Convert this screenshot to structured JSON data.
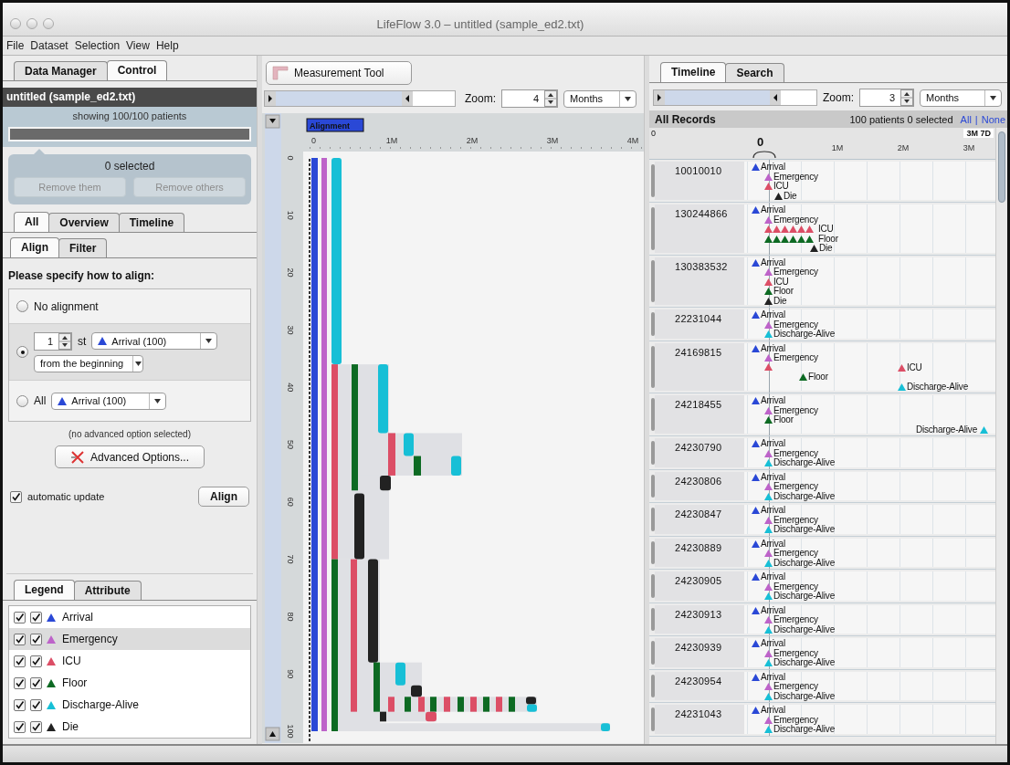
{
  "window": {
    "title": "LifeFlow 3.0 – untitled (sample_ed2.txt)"
  },
  "menu": [
    "File",
    "Dataset",
    "Selection",
    "View",
    "Help"
  ],
  "left": {
    "tabs": [
      {
        "label": "Data Manager",
        "selected": false
      },
      {
        "label": "Control",
        "selected": true
      }
    ],
    "dataset": {
      "title": "untitled (sample_ed2.txt)",
      "showing": "showing 100/100 patients",
      "level": 1
    },
    "selection": {
      "count": "0 selected",
      "buttons": [
        {
          "label": "Remove them",
          "disabled": true
        },
        {
          "label": "Remove others",
          "disabled": true
        }
      ]
    },
    "view_tabs": [
      {
        "label": "All",
        "selected": true
      },
      {
        "label": "Overview",
        "selected": false
      },
      {
        "label": "Timeline",
        "selected": false
      }
    ],
    "sub_tabs": [
      {
        "label": "Align",
        "selected": true
      },
      {
        "label": "Filter",
        "selected": false
      }
    ],
    "prompt": "Please specify how to align:",
    "align_options": [
      {
        "kind": "plain",
        "label": "No alignment",
        "selected": false
      },
      {
        "kind": "nth",
        "selected": true,
        "spinner": "1",
        "suffix": "st",
        "event": {
          "label": "Arrival (100)",
          "color": "#2a48d6"
        },
        "from": "from the beginning"
      },
      {
        "kind": "all",
        "label": "All",
        "selected": false,
        "event": {
          "label": "Arrival (100)",
          "color": "#2a48d6"
        }
      }
    ],
    "advanced_note": "(no advanced option selected)",
    "advanced_button": "Advanced Options...",
    "auto_update": {
      "label": "automatic update",
      "checked": true
    },
    "align_button": "Align",
    "legend_tabs": [
      {
        "label": "Legend",
        "selected": true
      },
      {
        "label": "Attribute",
        "selected": false
      }
    ],
    "legend": [
      {
        "label": "Arrival",
        "color": "#2a48d6",
        "checked": true,
        "included": true,
        "selected": false
      },
      {
        "label": "Emergency",
        "color": "#bd63c9",
        "checked": true,
        "included": true,
        "selected": true
      },
      {
        "label": "ICU",
        "color": "#dc4e66",
        "checked": true,
        "included": true,
        "selected": false
      },
      {
        "label": "Floor",
        "color": "#0d6a23",
        "checked": true,
        "included": true,
        "selected": false
      },
      {
        "label": "Discharge-Alive",
        "color": "#17bfd6",
        "checked": true,
        "included": true,
        "selected": false
      },
      {
        "label": "Die",
        "color": "#222222",
        "checked": true,
        "included": true,
        "selected": false
      }
    ]
  },
  "middle": {
    "measure_button": "Measurement Tool",
    "zoom": {
      "label": "Zoom:",
      "value": "4",
      "unit": "Months"
    },
    "alignment_tag": "Alignment",
    "x_ticks": [
      "0",
      "1M",
      "2M",
      "3M",
      "4M"
    ],
    "y_ticks": [
      "0",
      "10",
      "20",
      "30",
      "40",
      "50",
      "60",
      "70",
      "80",
      "90",
      "100"
    ]
  },
  "right": {
    "tabs": [
      {
        "label": "Timeline",
        "selected": true
      },
      {
        "label": "Search",
        "selected": false
      }
    ],
    "zoom": {
      "label": "Zoom:",
      "value": "3",
      "unit": "Months"
    },
    "header": {
      "title": "All Records",
      "summary": "100 patients 0 selected",
      "links": [
        "All",
        "None"
      ],
      "separator": "|"
    },
    "axis": {
      "start": "0",
      "end": "3M 7D",
      "zero": "0",
      "ticks": [
        "1M",
        "2M",
        "3M"
      ]
    },
    "records": [
      {
        "id": "10010010",
        "lines": [
          [
            {
              "kind": "first",
              "color": "#2a48d6",
              "label": "Arrival"
            }
          ],
          [
            {
              "kind": "zero",
              "color": "#bd63c9",
              "label": "Emergency"
            }
          ],
          [
            {
              "kind": "zero",
              "color": "#dc4e66",
              "label": "ICU"
            }
          ],
          [
            {
              "kind": "near",
              "color": "#222222",
              "label": "Die"
            }
          ]
        ]
      },
      {
        "id": "130244866",
        "lines": [
          [
            {
              "kind": "first",
              "color": "#2a48d6",
              "label": "Arrival"
            }
          ],
          [
            {
              "kind": "zero",
              "color": "#bd63c9",
              "label": "Emergency"
            }
          ],
          [
            {
              "kind": "cluster",
              "color": "#dc4e66",
              "label": "ICU"
            }
          ],
          [
            {
              "kind": "cluster",
              "color": "#0d6a23",
              "label": "Floor"
            }
          ],
          [
            {
              "kind": "after",
              "color": "#222222",
              "label": "Die"
            }
          ]
        ]
      },
      {
        "id": "130383532",
        "lines": [
          [
            {
              "kind": "first",
              "color": "#2a48d6",
              "label": "Arrival"
            }
          ],
          [
            {
              "kind": "zero",
              "color": "#bd63c9",
              "label": "Emergency"
            }
          ],
          [
            {
              "kind": "zero",
              "color": "#dc4e66",
              "label": "ICU"
            }
          ],
          [
            {
              "kind": "zero",
              "color": "#0d6a23",
              "label": "Floor"
            }
          ],
          [
            {
              "kind": "zero",
              "color": "#222222",
              "label": "Die"
            }
          ]
        ]
      },
      {
        "id": "22231044",
        "lines": [
          [
            {
              "kind": "first",
              "color": "#2a48d6",
              "label": "Arrival"
            }
          ],
          [
            {
              "kind": "zero",
              "color": "#bd63c9",
              "label": "Emergency"
            }
          ],
          [
            {
              "kind": "zero",
              "color": "#17bfd6",
              "label": "Discharge-Alive"
            }
          ]
        ]
      },
      {
        "id": "24169815",
        "lines": [
          [
            {
              "kind": "first",
              "color": "#2a48d6",
              "label": "Arrival"
            }
          ],
          [
            {
              "kind": "zero",
              "color": "#bd63c9",
              "label": "Emergency"
            }
          ],
          [
            {
              "kind": "zero",
              "color": "#dc4e66"
            },
            {
              "kind": "far",
              "color": "#dc4e66",
              "label": "ICU"
            }
          ],
          [
            {
              "kind": "half",
              "color": "#0d6a23",
              "label": "Floor"
            }
          ],
          [
            {
              "kind": "far",
              "color": "#17bfd6",
              "label": "Discharge-Alive"
            }
          ]
        ]
      },
      {
        "id": "24218455",
        "lines": [
          [
            {
              "kind": "first",
              "color": "#2a48d6",
              "label": "Arrival"
            }
          ],
          [
            {
              "kind": "zero",
              "color": "#bd63c9",
              "label": "Emergency"
            }
          ],
          [
            {
              "kind": "zero",
              "color": "#0d6a23",
              "label": "Floor"
            }
          ],
          [
            {
              "kind": "far-left",
              "color": "#17bfd6",
              "label": "Discharge-Alive"
            }
          ]
        ]
      },
      {
        "id": "24230790",
        "lines": [
          [
            {
              "kind": "first",
              "color": "#2a48d6",
              "label": "Arrival"
            }
          ],
          [
            {
              "kind": "zero",
              "color": "#bd63c9",
              "label": "Emergency"
            }
          ],
          [
            {
              "kind": "zero",
              "color": "#17bfd6",
              "label": "Discharge-Alive"
            }
          ]
        ]
      },
      {
        "id": "24230806",
        "lines": [
          [
            {
              "kind": "first",
              "color": "#2a48d6",
              "label": "Arrival"
            }
          ],
          [
            {
              "kind": "zero",
              "color": "#bd63c9",
              "label": "Emergency"
            }
          ],
          [
            {
              "kind": "zero",
              "color": "#17bfd6",
              "label": "Discharge-Alive"
            }
          ]
        ]
      },
      {
        "id": "24230847",
        "lines": [
          [
            {
              "kind": "first",
              "color": "#2a48d6",
              "label": "Arrival"
            }
          ],
          [
            {
              "kind": "zero",
              "color": "#bd63c9",
              "label": "Emergency"
            }
          ],
          [
            {
              "kind": "zero",
              "color": "#17bfd6",
              "label": "Discharge-Alive"
            }
          ]
        ]
      },
      {
        "id": "24230889",
        "lines": [
          [
            {
              "kind": "first",
              "color": "#2a48d6",
              "label": "Arrival"
            }
          ],
          [
            {
              "kind": "zero",
              "color": "#bd63c9",
              "label": "Emergency"
            }
          ],
          [
            {
              "kind": "zero",
              "color": "#17bfd6",
              "label": "Discharge-Alive"
            }
          ]
        ]
      },
      {
        "id": "24230905",
        "lines": [
          [
            {
              "kind": "first",
              "color": "#2a48d6",
              "label": "Arrival"
            }
          ],
          [
            {
              "kind": "zero",
              "color": "#bd63c9",
              "label": "Emergency"
            }
          ],
          [
            {
              "kind": "zero",
              "color": "#17bfd6",
              "label": "Discharge-Alive"
            }
          ]
        ]
      },
      {
        "id": "24230913",
        "lines": [
          [
            {
              "kind": "first",
              "color": "#2a48d6",
              "label": "Arrival"
            }
          ],
          [
            {
              "kind": "zero",
              "color": "#bd63c9",
              "label": "Emergency"
            }
          ],
          [
            {
              "kind": "zero",
              "color": "#17bfd6",
              "label": "Discharge-Alive"
            }
          ]
        ]
      },
      {
        "id": "24230939",
        "lines": [
          [
            {
              "kind": "first",
              "color": "#2a48d6",
              "label": "Arrival"
            }
          ],
          [
            {
              "kind": "zero",
              "color": "#bd63c9",
              "label": "Emergency"
            }
          ],
          [
            {
              "kind": "zero",
              "color": "#17bfd6",
              "label": "Discharge-Alive"
            }
          ]
        ]
      },
      {
        "id": "24230954",
        "lines": [
          [
            {
              "kind": "first",
              "color": "#2a48d6",
              "label": "Arrival"
            }
          ],
          [
            {
              "kind": "zero",
              "color": "#bd63c9",
              "label": "Emergency"
            }
          ],
          [
            {
              "kind": "zero",
              "color": "#17bfd6",
              "label": "Discharge-Alive"
            }
          ]
        ]
      },
      {
        "id": "24231043",
        "lines": [
          [
            {
              "kind": "first",
              "color": "#2a48d6",
              "label": "Arrival"
            }
          ],
          [
            {
              "kind": "zero",
              "color": "#bd63c9",
              "label": "Emergency"
            }
          ],
          [
            {
              "kind": "zero",
              "color": "#17bfd6",
              "label": "Discharge-Alive"
            }
          ]
        ]
      }
    ]
  }
}
